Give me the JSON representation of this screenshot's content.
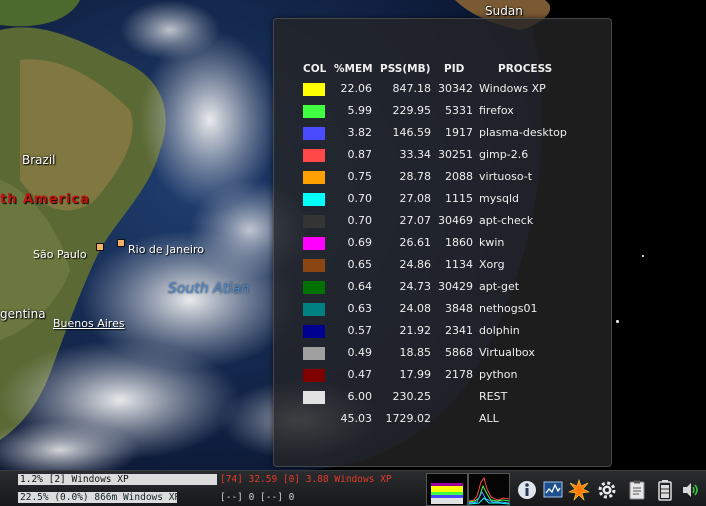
{
  "map": {
    "labels": {
      "brazil": "Brazil",
      "south_america": "th America",
      "sao_paulo": "São Paulo",
      "rio": "Rio de Janeiro",
      "ocean": "South Atlan",
      "argentina": "gentina",
      "buenos_aires": "Buenos Aires",
      "sudan": "Sudan"
    }
  },
  "memory_panel": {
    "columns": [
      "COL",
      "%MEM",
      "PSS(MB)",
      "PID",
      "PROCESS"
    ],
    "rows": [
      {
        "color": "#ffff00",
        "mem": "22.06",
        "pss": "847.18",
        "pid": "30342",
        "process": "Windows XP"
      },
      {
        "color": "#40ff40",
        "mem": "5.99",
        "pss": "229.95",
        "pid": "5331",
        "process": "firefox"
      },
      {
        "color": "#4a4aff",
        "mem": "3.82",
        "pss": "146.59",
        "pid": "1917",
        "process": "plasma-desktop"
      },
      {
        "color": "#ff4848",
        "mem": "0.87",
        "pss": "33.34",
        "pid": "30251",
        "process": "gimp-2.6"
      },
      {
        "color": "#ffa000",
        "mem": "0.75",
        "pss": "28.78",
        "pid": "2088",
        "process": "virtuoso-t"
      },
      {
        "color": "#00ffff",
        "mem": "0.70",
        "pss": "27.08",
        "pid": "1115",
        "process": "mysqld"
      },
      {
        "color": "#353535",
        "mem": "0.70",
        "pss": "27.07",
        "pid": "30469",
        "process": "apt-check"
      },
      {
        "color": "#ff00ff",
        "mem": "0.69",
        "pss": "26.61",
        "pid": "1860",
        "process": "kwin"
      },
      {
        "color": "#8b4513",
        "mem": "0.65",
        "pss": "24.86",
        "pid": "1134",
        "process": "Xorg"
      },
      {
        "color": "#007000",
        "mem": "0.64",
        "pss": "24.73",
        "pid": "30429",
        "process": "apt-get"
      },
      {
        "color": "#008080",
        "mem": "0.63",
        "pss": "24.08",
        "pid": "3848",
        "process": "nethogs01"
      },
      {
        "color": "#000090",
        "mem": "0.57",
        "pss": "21.92",
        "pid": "2341",
        "process": "dolphin"
      },
      {
        "color": "#a0a0a0",
        "mem": "0.49",
        "pss": "18.85",
        "pid": "5868",
        "process": "Virtualbox"
      },
      {
        "color": "#800000",
        "mem": "0.47",
        "pss": "17.99",
        "pid": "2178",
        "process": "python"
      },
      {
        "color": "#e2e2e2",
        "mem": "6.00",
        "pss": "230.25",
        "pid": "",
        "process": "REST"
      },
      {
        "color": "",
        "mem": "45.03",
        "pss": "1729.02",
        "pid": "",
        "process": "ALL"
      }
    ]
  },
  "taskbar": {
    "ram_text": "1.2% [2] Windows XP",
    "cpu_text": "22.5% (0.0%) 866m Windows XP",
    "temp_text": "[74] 32.59 [0] 3.88 Windows XP",
    "io_text": "[--] 0  [--] 0",
    "tray_icons": [
      "info-icon",
      "system-monitor-icon",
      "burst-notification-icon",
      "settings-gear-icon",
      "clipboard-icon",
      "battery-icon",
      "volume-icon"
    ]
  }
}
